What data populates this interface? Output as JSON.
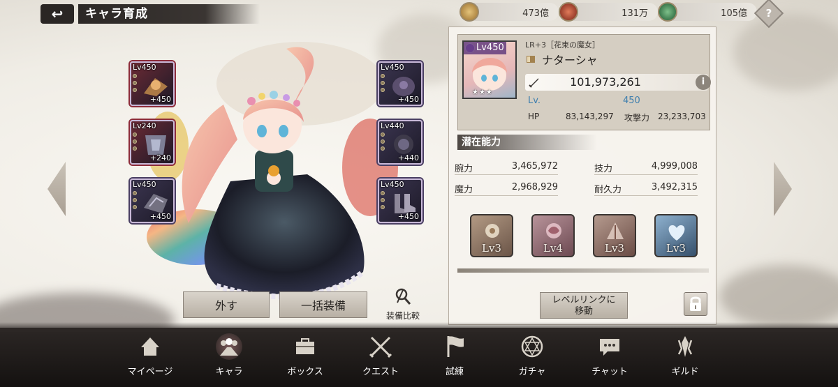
{
  "header": {
    "back_label": "↩",
    "title": "キャラ育成",
    "currencies": [
      {
        "name": "gold-coin",
        "value": "473億",
        "color": "#b98c45"
      },
      {
        "name": "red-orb",
        "value": "131万",
        "color": "#b84a3a"
      },
      {
        "name": "green-orb",
        "value": "105億",
        "color": "#3f8a5a"
      }
    ],
    "help_label": "?"
  },
  "equipment": {
    "left": [
      {
        "level": "Lv450",
        "plus": "+450",
        "rarity": "red"
      },
      {
        "level": "Lv240",
        "plus": "+240",
        "rarity": "red"
      },
      {
        "level": "Lv450",
        "plus": "+450",
        "rarity": "purple"
      }
    ],
    "right": [
      {
        "level": "Lv450",
        "plus": "+450",
        "rarity": "purple"
      },
      {
        "level": "Lv440",
        "plus": "+440",
        "rarity": "purple"
      },
      {
        "level": "Lv450",
        "plus": "+450",
        "rarity": "purple"
      }
    ]
  },
  "actions": {
    "remove_label": "外す",
    "equip_all_label": "一括装備",
    "compare_label": "装備比較"
  },
  "character": {
    "portrait_level": "Lv450",
    "stars": "★★★",
    "rarity_title": "LR+3［花束の魔女］",
    "name": "ナターシャ",
    "power": "101,973,261",
    "info_label": "i",
    "lv_label": "Lv.",
    "lv_value": "450",
    "hp_label": "HP",
    "hp_value": "83,143,297",
    "atk_label": "攻撃力",
    "atk_value": "23,233,703"
  },
  "potential": {
    "header": "潜在能力",
    "stats": [
      {
        "name": "腕力",
        "value": "3,465,972"
      },
      {
        "name": "技力",
        "value": "4,999,008"
      },
      {
        "name": "魔力",
        "value": "2,968,929"
      },
      {
        "name": "耐久力",
        "value": "3,492,315"
      }
    ],
    "skills": [
      {
        "level": "Lv3"
      },
      {
        "level": "Lv4"
      },
      {
        "level": "Lv3"
      },
      {
        "level": "Lv3"
      }
    ],
    "level_link_label_1": "レベルリンクに",
    "level_link_label_2": "移動"
  },
  "nav": [
    {
      "label": "マイページ"
    },
    {
      "label": "キャラ"
    },
    {
      "label": "ボックス"
    },
    {
      "label": "クエスト"
    },
    {
      "label": "試練"
    },
    {
      "label": "ガチャ"
    },
    {
      "label": "チャット"
    },
    {
      "label": "ギルド"
    }
  ]
}
